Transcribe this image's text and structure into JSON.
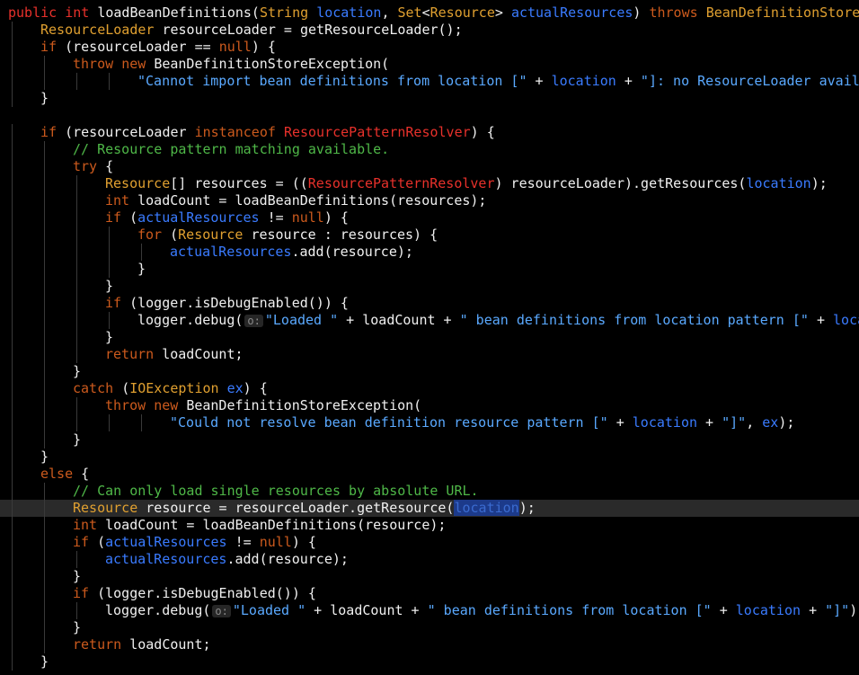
{
  "lines": [
    {
      "indent": 0,
      "current": false,
      "tokens": [
        {
          "t": "public ",
          "c": "kw2"
        },
        {
          "t": "int ",
          "c": "kw2"
        },
        {
          "t": "loadBeanDefinitions(",
          "c": "plain"
        },
        {
          "t": "String ",
          "c": "type"
        },
        {
          "t": "location",
          "c": "field"
        },
        {
          "t": ", ",
          "c": "plain"
        },
        {
          "t": "Set",
          "c": "type"
        },
        {
          "t": "<",
          "c": "plain"
        },
        {
          "t": "Resource",
          "c": "type"
        },
        {
          "t": "> ",
          "c": "plain"
        },
        {
          "t": "actualResources",
          "c": "field"
        },
        {
          "t": ") ",
          "c": "plain"
        },
        {
          "t": "throws ",
          "c": "kw"
        },
        {
          "t": "BeanDefinitionStoreException {",
          "c": "type"
        }
      ]
    },
    {
      "indent": 1,
      "current": false,
      "tokens": [
        {
          "t": "ResourceLoader ",
          "c": "type"
        },
        {
          "t": "resourceLoader = getResourceLoader();",
          "c": "plain"
        }
      ]
    },
    {
      "indent": 1,
      "current": false,
      "tokens": [
        {
          "t": "if ",
          "c": "kw"
        },
        {
          "t": "(resourceLoader == ",
          "c": "plain"
        },
        {
          "t": "null",
          "c": "kw"
        },
        {
          "t": ") {",
          "c": "plain"
        }
      ]
    },
    {
      "indent": 2,
      "current": false,
      "tokens": [
        {
          "t": "throw ",
          "c": "kw"
        },
        {
          "t": "new ",
          "c": "kw"
        },
        {
          "t": "BeanDefinitionStoreException(",
          "c": "plain"
        }
      ]
    },
    {
      "indent": 4,
      "current": false,
      "tokens": [
        {
          "t": "\"Cannot import bean definitions from location [\" ",
          "c": "string"
        },
        {
          "t": "+ ",
          "c": "plain"
        },
        {
          "t": "location ",
          "c": "field"
        },
        {
          "t": "+ ",
          "c": "plain"
        },
        {
          "t": "\"]: no ResourceLoader available\"",
          "c": "string"
        },
        {
          "t": ");",
          "c": "plain"
        }
      ]
    },
    {
      "indent": 1,
      "current": false,
      "tokens": [
        {
          "t": "}",
          "c": "plain"
        }
      ]
    },
    {
      "indent": 0,
      "current": false,
      "tokens": []
    },
    {
      "indent": 1,
      "current": false,
      "tokens": [
        {
          "t": "if ",
          "c": "kw"
        },
        {
          "t": "(resourceLoader ",
          "c": "plain"
        },
        {
          "t": "instanceof ",
          "c": "kw"
        },
        {
          "t": "ResourcePatternResolver",
          "c": "kw2"
        },
        {
          "t": ") {",
          "c": "plain"
        }
      ]
    },
    {
      "indent": 2,
      "current": false,
      "tokens": [
        {
          "t": "// Resource pattern matching available.",
          "c": "comment"
        }
      ]
    },
    {
      "indent": 2,
      "current": false,
      "tokens": [
        {
          "t": "try ",
          "c": "kw"
        },
        {
          "t": "{",
          "c": "plain"
        }
      ]
    },
    {
      "indent": 3,
      "current": false,
      "tokens": [
        {
          "t": "Resource",
          "c": "type"
        },
        {
          "t": "[] resources = ((",
          "c": "plain"
        },
        {
          "t": "ResourcePatternResolver",
          "c": "kw2"
        },
        {
          "t": ") resourceLoader).getResources(",
          "c": "plain"
        },
        {
          "t": "location",
          "c": "field"
        },
        {
          "t": ");",
          "c": "plain"
        }
      ]
    },
    {
      "indent": 3,
      "current": false,
      "tokens": [
        {
          "t": "int ",
          "c": "kw"
        },
        {
          "t": "loadCount = loadBeanDefinitions(resources);",
          "c": "plain"
        }
      ]
    },
    {
      "indent": 3,
      "current": false,
      "tokens": [
        {
          "t": "if ",
          "c": "kw"
        },
        {
          "t": "(",
          "c": "plain"
        },
        {
          "t": "actualResources ",
          "c": "field"
        },
        {
          "t": "!= ",
          "c": "plain"
        },
        {
          "t": "null",
          "c": "kw"
        },
        {
          "t": ") {",
          "c": "plain"
        }
      ]
    },
    {
      "indent": 4,
      "current": false,
      "tokens": [
        {
          "t": "for ",
          "c": "kw"
        },
        {
          "t": "(",
          "c": "plain"
        },
        {
          "t": "Resource ",
          "c": "type"
        },
        {
          "t": "resource : resources) {",
          "c": "plain"
        }
      ]
    },
    {
      "indent": 5,
      "current": false,
      "tokens": [
        {
          "t": "actualResources",
          "c": "field"
        },
        {
          "t": ".add(resource);",
          "c": "plain"
        }
      ]
    },
    {
      "indent": 4,
      "current": false,
      "tokens": [
        {
          "t": "}",
          "c": "plain"
        }
      ]
    },
    {
      "indent": 3,
      "current": false,
      "tokens": [
        {
          "t": "}",
          "c": "plain"
        }
      ]
    },
    {
      "indent": 3,
      "current": false,
      "tokens": [
        {
          "t": "if ",
          "c": "kw"
        },
        {
          "t": "(logger.isDebugEnabled()) {",
          "c": "plain"
        }
      ]
    },
    {
      "indent": 4,
      "current": false,
      "tokens": [
        {
          "t": "logger.debug(",
          "c": "plain"
        },
        {
          "t": "o:",
          "c": "hint"
        },
        {
          "t": "\"Loaded \" ",
          "c": "string"
        },
        {
          "t": "+ loadCount + ",
          "c": "plain"
        },
        {
          "t": "\" bean definitions from location pattern [\" ",
          "c": "string"
        },
        {
          "t": "+ ",
          "c": "plain"
        },
        {
          "t": "location",
          "c": "field"
        }
      ]
    },
    {
      "indent": 3,
      "current": false,
      "tokens": [
        {
          "t": "}",
          "c": "plain"
        }
      ]
    },
    {
      "indent": 3,
      "current": false,
      "tokens": [
        {
          "t": "return ",
          "c": "kw"
        },
        {
          "t": "loadCount;",
          "c": "plain"
        }
      ]
    },
    {
      "indent": 2,
      "current": false,
      "tokens": [
        {
          "t": "}",
          "c": "plain"
        }
      ]
    },
    {
      "indent": 2,
      "current": false,
      "tokens": [
        {
          "t": "catch ",
          "c": "kw"
        },
        {
          "t": "(",
          "c": "plain"
        },
        {
          "t": "IOException ",
          "c": "type"
        },
        {
          "t": "ex",
          "c": "field"
        },
        {
          "t": ") {",
          "c": "plain"
        }
      ]
    },
    {
      "indent": 3,
      "current": false,
      "tokens": [
        {
          "t": "throw ",
          "c": "kw"
        },
        {
          "t": "new ",
          "c": "kw"
        },
        {
          "t": "BeanDefinitionStoreException(",
          "c": "plain"
        }
      ]
    },
    {
      "indent": 5,
      "current": false,
      "tokens": [
        {
          "t": "\"Could not resolve bean definition resource pattern [\" ",
          "c": "string"
        },
        {
          "t": "+ ",
          "c": "plain"
        },
        {
          "t": "location ",
          "c": "field"
        },
        {
          "t": "+ ",
          "c": "plain"
        },
        {
          "t": "\"]\"",
          "c": "string"
        },
        {
          "t": ", ",
          "c": "plain"
        },
        {
          "t": "ex",
          "c": "field"
        },
        {
          "t": ");",
          "c": "plain"
        }
      ]
    },
    {
      "indent": 2,
      "current": false,
      "tokens": [
        {
          "t": "}",
          "c": "plain"
        }
      ]
    },
    {
      "indent": 1,
      "current": false,
      "tokens": [
        {
          "t": "}",
          "c": "plain"
        }
      ]
    },
    {
      "indent": 1,
      "current": false,
      "tokens": [
        {
          "t": "else ",
          "c": "kw"
        },
        {
          "t": "{",
          "c": "plain"
        }
      ]
    },
    {
      "indent": 2,
      "current": false,
      "tokens": [
        {
          "t": "// Can only load single resources by absolute URL.",
          "c": "comment"
        }
      ]
    },
    {
      "indent": 2,
      "current": true,
      "tokens": [
        {
          "t": "Resource ",
          "c": "type"
        },
        {
          "t": "resource = resourceLoader.getResource(",
          "c": "plain"
        },
        {
          "t": "location",
          "c": "sel"
        },
        {
          "t": ");",
          "c": "plain"
        }
      ]
    },
    {
      "indent": 2,
      "current": false,
      "tokens": [
        {
          "t": "int ",
          "c": "kw"
        },
        {
          "t": "loadCount = loadBeanDefinitions(resource);",
          "c": "plain"
        }
      ]
    },
    {
      "indent": 2,
      "current": false,
      "tokens": [
        {
          "t": "if ",
          "c": "kw"
        },
        {
          "t": "(",
          "c": "plain"
        },
        {
          "t": "actualResources ",
          "c": "field"
        },
        {
          "t": "!= ",
          "c": "plain"
        },
        {
          "t": "null",
          "c": "kw"
        },
        {
          "t": ") {",
          "c": "plain"
        }
      ]
    },
    {
      "indent": 3,
      "current": false,
      "tokens": [
        {
          "t": "actualResources",
          "c": "field"
        },
        {
          "t": ".add(resource);",
          "c": "plain"
        }
      ]
    },
    {
      "indent": 2,
      "current": false,
      "tokens": [
        {
          "t": "}",
          "c": "plain"
        }
      ]
    },
    {
      "indent": 2,
      "current": false,
      "tokens": [
        {
          "t": "if ",
          "c": "kw"
        },
        {
          "t": "(logger.isDebugEnabled()) {",
          "c": "plain"
        }
      ]
    },
    {
      "indent": 3,
      "current": false,
      "tokens": [
        {
          "t": "logger.debug(",
          "c": "plain"
        },
        {
          "t": "o:",
          "c": "hint"
        },
        {
          "t": "\"Loaded \" ",
          "c": "string"
        },
        {
          "t": "+ loadCount + ",
          "c": "plain"
        },
        {
          "t": "\" bean definitions from location [\" ",
          "c": "string"
        },
        {
          "t": "+ ",
          "c": "plain"
        },
        {
          "t": "location ",
          "c": "field"
        },
        {
          "t": "+ ",
          "c": "plain"
        },
        {
          "t": "\"]\"",
          "c": "string"
        },
        {
          "t": ");",
          "c": "plain"
        }
      ]
    },
    {
      "indent": 2,
      "current": false,
      "tokens": [
        {
          "t": "}",
          "c": "plain"
        }
      ]
    },
    {
      "indent": 2,
      "current": false,
      "tokens": [
        {
          "t": "return ",
          "c": "kw"
        },
        {
          "t": "loadCount;",
          "c": "plain"
        }
      ]
    },
    {
      "indent": 1,
      "current": false,
      "tokens": [
        {
          "t": "}",
          "c": "plain"
        }
      ]
    }
  ]
}
